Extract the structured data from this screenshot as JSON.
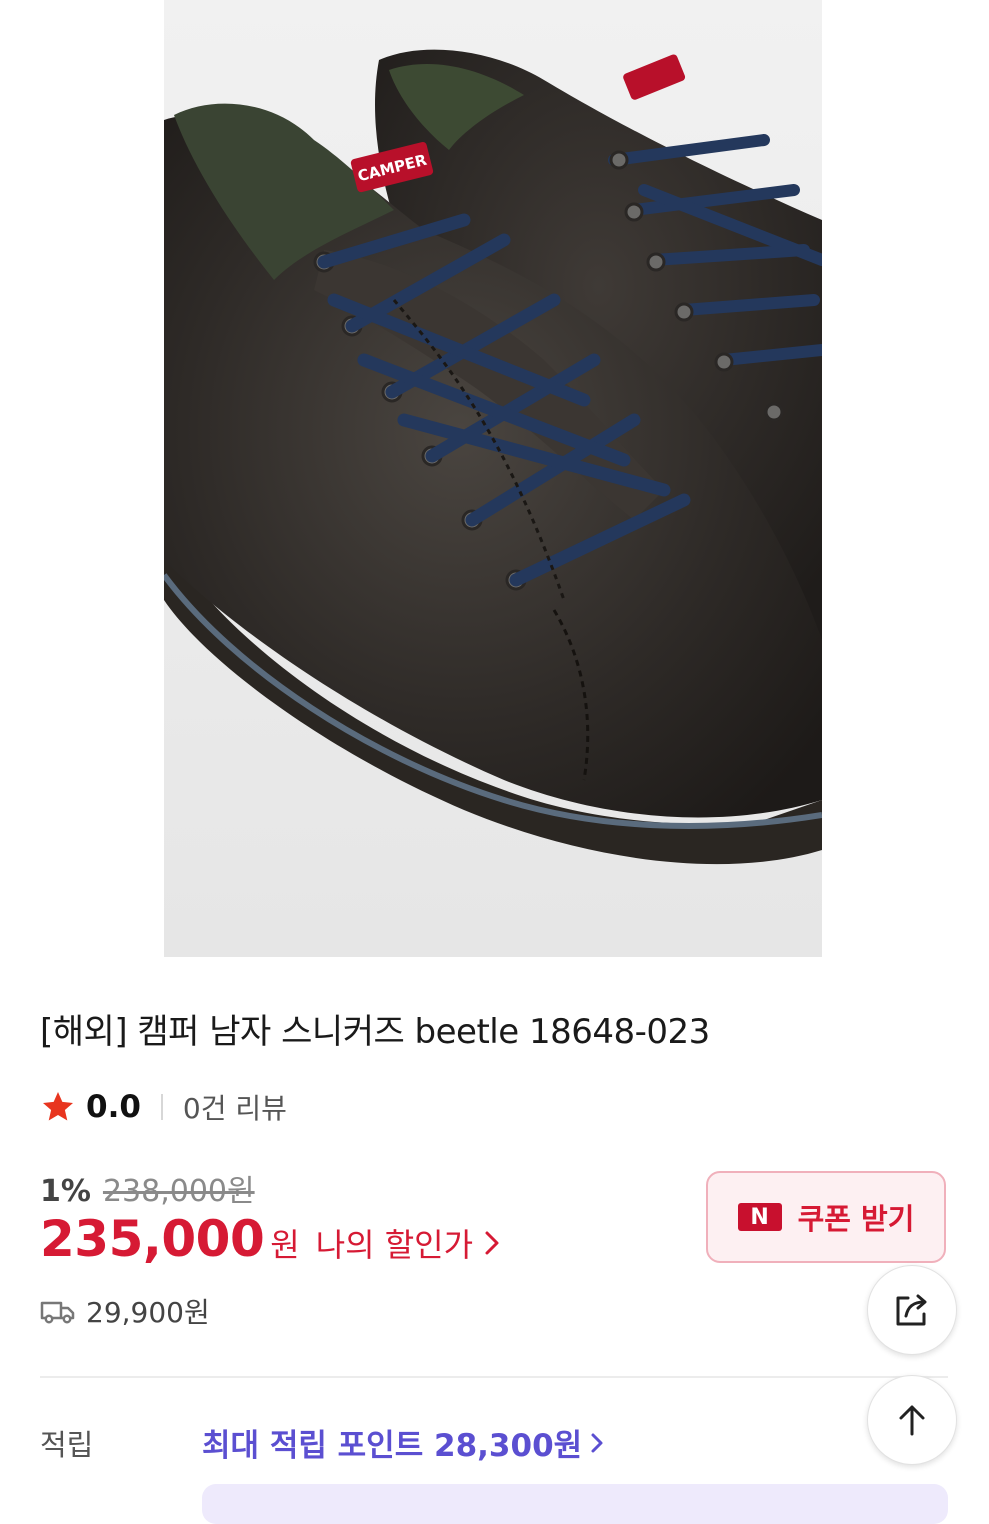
{
  "product": {
    "title": "[해외] 캠퍼 남자 스니커즈 beetle 18648-023",
    "image_alt": "캠퍼 beetle 스니커즈",
    "brand_tag": "CAMPER"
  },
  "rating": {
    "score": "0.0",
    "review_count_text": "0건 리뷰"
  },
  "pricing": {
    "discount_rate": "1%",
    "original_price": "238,000원",
    "price": "235,000",
    "price_unit": "원",
    "my_discount_label": "나의 할인가"
  },
  "coupon": {
    "icon_text": "N",
    "label": "쿠폰 받기"
  },
  "shipping": {
    "fee": "29,900원"
  },
  "points": {
    "label": "적립",
    "link_text": "최대 적립 포인트 28,300원"
  },
  "colors": {
    "accent_red": "#d61a34",
    "points_purple": "#5b4fd1",
    "star": "#e8351f"
  },
  "icons": {
    "star": "star-icon",
    "chevron": "chevron-right-icon",
    "truck": "truck-icon",
    "share": "share-icon",
    "scroll_top": "arrow-up-icon"
  }
}
